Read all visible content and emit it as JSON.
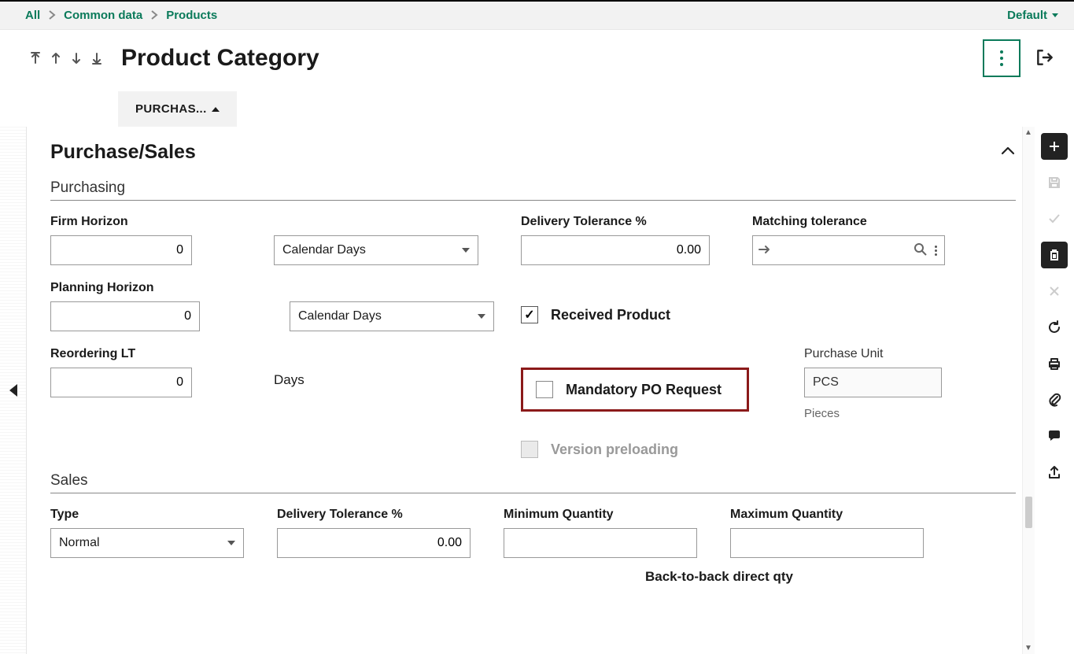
{
  "breadcrumb": {
    "items": [
      "All",
      "Common data",
      "Products"
    ],
    "right": "Default"
  },
  "header": {
    "title": "Product Category",
    "tab": "PURCHAS..."
  },
  "section": {
    "title": "Purchase/Sales"
  },
  "purchasing": {
    "title": "Purchasing",
    "firm_horizon_label": "Firm Horizon",
    "firm_horizon_value": "0",
    "firm_horizon_unit": "Calendar Days",
    "planning_horizon_label": "Planning Horizon",
    "planning_horizon_value": "0",
    "planning_horizon_unit": "Calendar Days",
    "reordering_lt_label": "Reordering LT",
    "reordering_lt_value": "0",
    "reordering_lt_unit": "Days",
    "delivery_tol_label": "Delivery Tolerance %",
    "delivery_tol_value": "0.00",
    "matching_tol_label": "Matching tolerance",
    "received_product_label": "Received Product",
    "mandatory_po_label": "Mandatory PO Request",
    "version_preloading_label": "Version preloading",
    "purchase_unit_label": "Purchase Unit",
    "purchase_unit_value": "PCS",
    "purchase_unit_sub": "Pieces"
  },
  "sales": {
    "title": "Sales",
    "type_label": "Type",
    "type_value": "Normal",
    "delivery_tol_label": "Delivery Tolerance %",
    "delivery_tol_value": "0.00",
    "min_qty_label": "Minimum Quantity",
    "max_qty_label": "Maximum Quantity",
    "b2b_label": "Back-to-back direct qty"
  }
}
